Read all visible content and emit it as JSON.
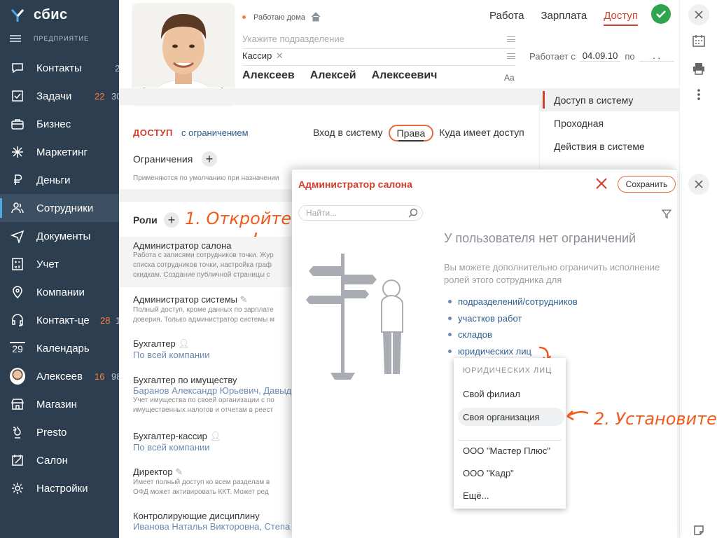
{
  "sidebar": {
    "logo": "сбис",
    "company": "ПРЕДПРИЯТИЕ",
    "items": [
      {
        "label": "Контакты",
        "icon": "chat-icon",
        "count": "2",
        "count2": ""
      },
      {
        "label": "Задачи",
        "icon": "tasks-icon",
        "count": "22",
        "count2": "30"
      },
      {
        "label": "Бизнес",
        "icon": "briefcase-icon",
        "count": "",
        "count2": ""
      },
      {
        "label": "Маркетинг",
        "icon": "spark-icon",
        "count": "",
        "count2": ""
      },
      {
        "label": "Деньги",
        "icon": "ruble-icon",
        "count": "",
        "count2": ""
      },
      {
        "label": "Сотрудники",
        "icon": "people-icon",
        "count": "",
        "count2": ""
      },
      {
        "label": "Документы",
        "icon": "paper-plane-icon",
        "count": "",
        "count2": ""
      },
      {
        "label": "Учет",
        "icon": "calculator-icon",
        "count": "",
        "count2": ""
      },
      {
        "label": "Компании",
        "icon": "location-icon",
        "count": "",
        "count2": ""
      },
      {
        "label": "Контакт-це",
        "icon": "headset-icon",
        "count": "28",
        "count2": "1"
      },
      {
        "label": "Календарь",
        "icon": "calendar-icon",
        "count": "",
        "count2": ""
      },
      {
        "label": "Алексеев",
        "icon": "avatar",
        "count": "16",
        "count2": "98"
      },
      {
        "label": "Магазин",
        "icon": "store-icon",
        "count": "",
        "count2": ""
      },
      {
        "label": "Presto",
        "icon": "presto-icon",
        "count": "",
        "count2": ""
      },
      {
        "label": "Салон",
        "icon": "salon-icon",
        "count": "",
        "count2": ""
      },
      {
        "label": "Настройки",
        "icon": "gear-icon",
        "count": "",
        "count2": ""
      }
    ],
    "calendar_day": "29"
  },
  "employee": {
    "status": "Работаю дома",
    "department_placeholder": "Укажите подразделение",
    "position": "Кассир",
    "works_since_label": "Работает с",
    "works_since_date": "04.09.10",
    "works_to_label": "по",
    "works_to_date": ". .",
    "last_name": "Алексеев",
    "first_name": "Алексей",
    "middle_name": "Алексеевич",
    "font_toggle": "Aa"
  },
  "top_tabs": [
    "Работа",
    "Зарплата",
    "Доступ"
  ],
  "access": {
    "title": "ДОСТУП",
    "subtitle": "с ограничением",
    "subtabs": [
      "Вход в систему",
      "Права",
      "Куда имеет доступ"
    ],
    "restrictions_label": "Ограничения",
    "restrictions_hint": "Применяются по умолчанию при назначении",
    "roles_label": "Роли",
    "annotation1": "1. Откройте"
  },
  "roles": [
    {
      "title": "Администратор салона",
      "desc": [
        "Работа с записями сотрудников точки. Жур",
        "списка сотрудников точки, настройка граф",
        "скидкам. Создание публичной страницы с"
      ],
      "sub": ""
    },
    {
      "title": "Администратор системы",
      "desc": [
        "Полный доступ, кроме данных по зарплате",
        "доверия. Только администратор системы м"
      ],
      "sub": ""
    },
    {
      "title": "Бухгалтер",
      "desc": [],
      "sub": "По всей компании"
    },
    {
      "title": "Бухгалтер по имуществу",
      "desc": [
        "Учет имущества по своей организации с по",
        "имущественных налогов и отчетам в реест"
      ],
      "sub": "Баранов Александр Юрьевич, Давыд"
    },
    {
      "title": "Бухгалтер-кассир",
      "desc": [],
      "sub": "По всей компании"
    },
    {
      "title": "Директор",
      "desc": [
        "Имеет полный доступ ко всем разделам в",
        "ОФД может активировать ККТ. Может ред"
      ],
      "sub": ""
    },
    {
      "title": "Контролирующие дисциплину",
      "desc": [],
      "sub": "Иванова Наталья Викторовна, Степа"
    }
  ],
  "right_menu": [
    "Доступ в систему",
    "Проходная",
    "Действия в системе"
  ],
  "modal": {
    "title": "Администратор салона",
    "save": "Сохранить",
    "search_placeholder": "Найти...",
    "empty_title": "У пользователя нет ограничений",
    "empty_text": "Вы можете дополнительно ограничить исполнение ролей этого сотрудника для",
    "links": [
      "подразделений/сотрудников",
      "участков работ",
      "складов",
      "юридических лиц"
    ]
  },
  "dropdown": {
    "header": "ЮРИДИЧЕСКИХ ЛИЦ",
    "items": [
      "Свой филиал",
      "Своя организация",
      "ООО \"Мастер Плюс\"",
      "ООО \"Кадр\"",
      "Ещё..."
    ],
    "annotation2": "2. Установите"
  },
  "colors": {
    "sidebar": "#2d3e50",
    "accent": "#d0402c",
    "annotation": "#f05a1a",
    "link": "#2d5d8e",
    "ok": "#2ea44f"
  }
}
